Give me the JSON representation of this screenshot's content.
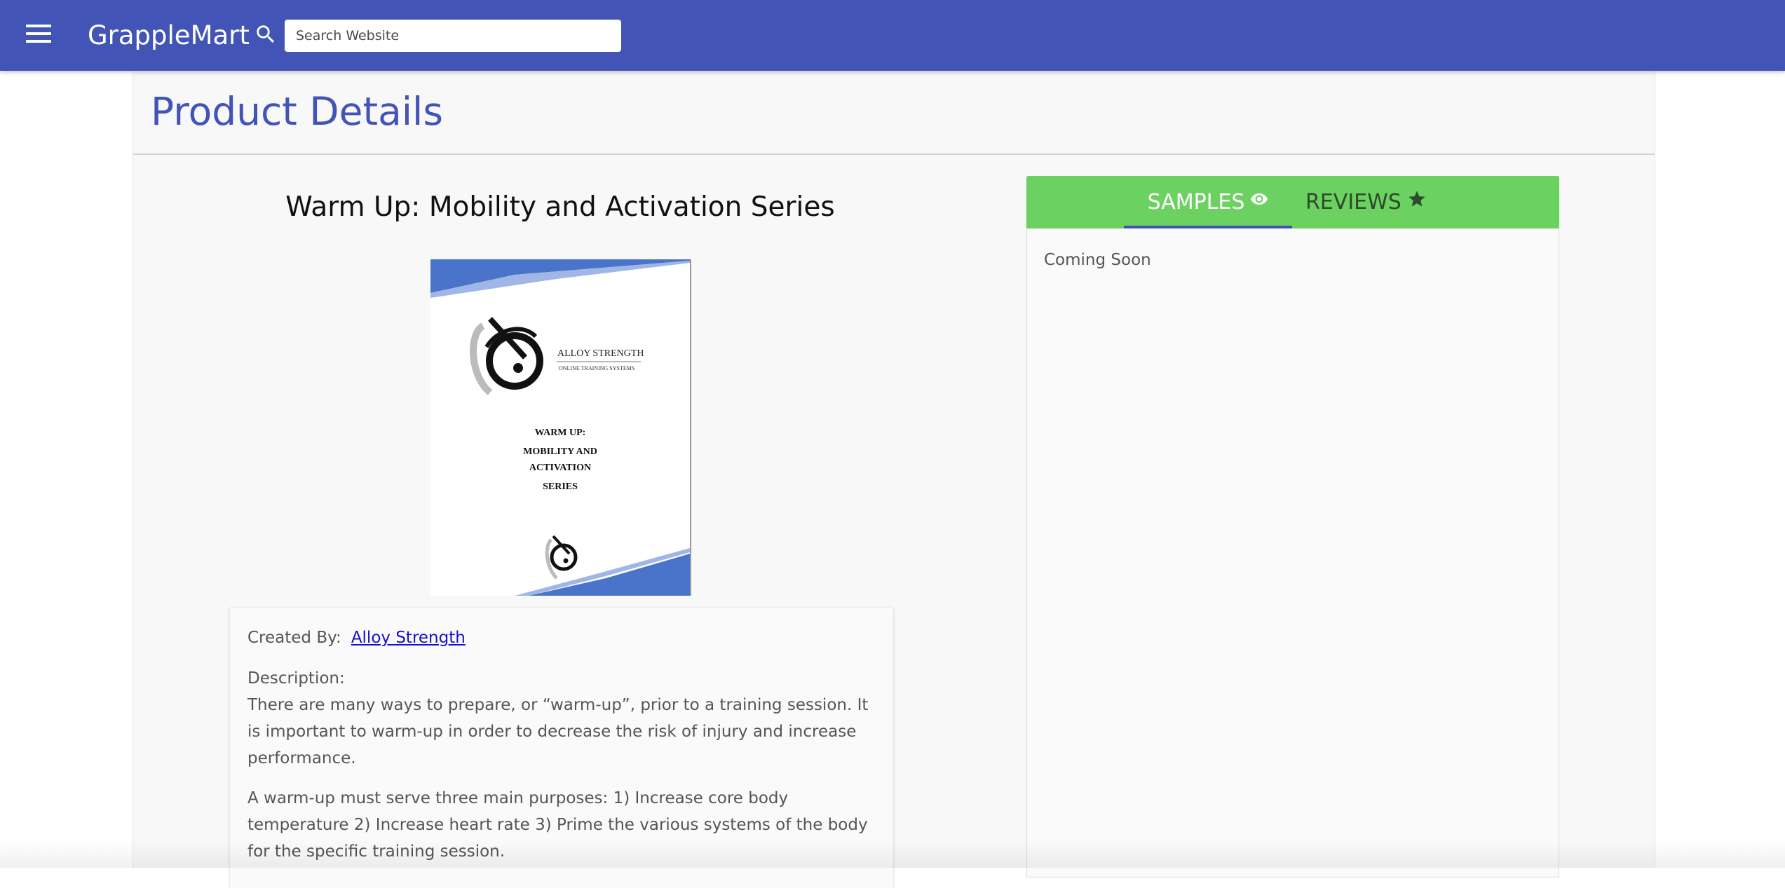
{
  "header": {
    "brand": "GrappleMart",
    "search": {
      "placeholder": "Search Website",
      "value": ""
    },
    "color": "#4254b5"
  },
  "page": {
    "title": "Product Details"
  },
  "product": {
    "title": "Warm Up: Mobility and Activation Series",
    "cover": {
      "brand_line1": "ALLOY STRENGTH",
      "brand_line2": "ONLINE TRAINING SYSTEMS",
      "title_lines": [
        "WARM UP:",
        "MOBILITY AND",
        "ACTIVATION",
        "SERIES"
      ]
    },
    "created_by_label": "Created By:",
    "creator": "Alloy Strength",
    "description_label": "Description:",
    "description_p1": "There are many ways to prepare, or “warm-up”, prior to a training session. It is important to warm-up in order to decrease the risk of injury and increase performance.",
    "description_p2": "A warm-up must serve three main purposes: 1) Increase core body temperature 2) Increase heart rate 3) Prime the various systems of the body for the specific training session."
  },
  "tabs": {
    "items": [
      {
        "label": "SAMPLES",
        "icon": "eye-icon",
        "active": true
      },
      {
        "label": "REVIEWS",
        "icon": "star-icon",
        "active": false
      }
    ],
    "bar_color": "#6bd160",
    "content": "Coming Soon"
  }
}
